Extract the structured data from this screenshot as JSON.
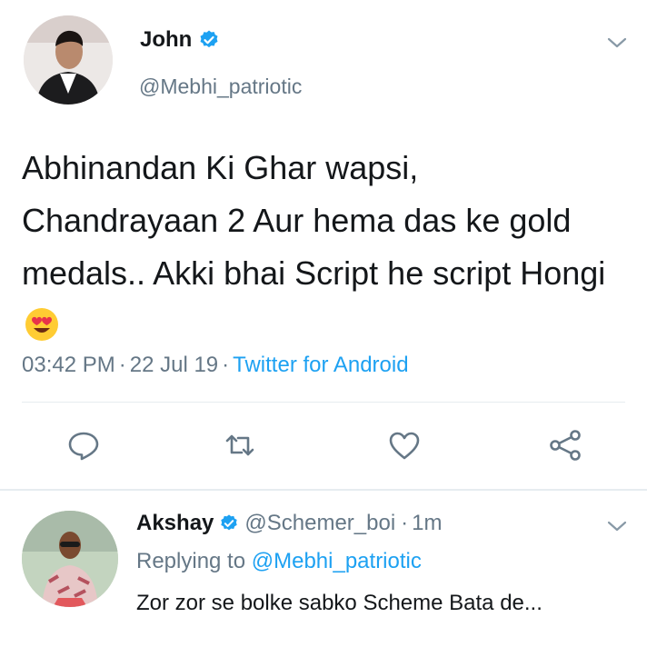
{
  "tweet": {
    "author_name": "John",
    "author_handle": "@Mebhi_patriotic",
    "text": "Abhinandan Ki Ghar wapsi, Chandrayaan 2 Aur hema das ke gold medals.. Akki bhai Script he script Hongi",
    "emoji": "smiling-face-with-heart-eyes",
    "time": "03:42 PM",
    "date": "22 Jul 19",
    "source": "Twitter for Android",
    "separator": "·"
  },
  "reply": {
    "author_name": "Akshay",
    "author_handle": "@Schemer_boi",
    "time": "1m",
    "separator": "·",
    "replying_prefix": "Replying to",
    "replying_handle": "@Mebhi_patriotic",
    "text": "Zor zor se bolke sabko Scheme Bata de..."
  },
  "icons": {
    "verified": "verified-badge-icon",
    "chevron": "chevron-down-icon",
    "reply": "reply-icon",
    "retweet": "retweet-icon",
    "like": "heart-icon",
    "share": "share-icon"
  },
  "colors": {
    "primary_text": "#14171a",
    "secondary_text": "#657786",
    "link_blue": "#1da1f2",
    "divider": "#e6ecf0"
  }
}
